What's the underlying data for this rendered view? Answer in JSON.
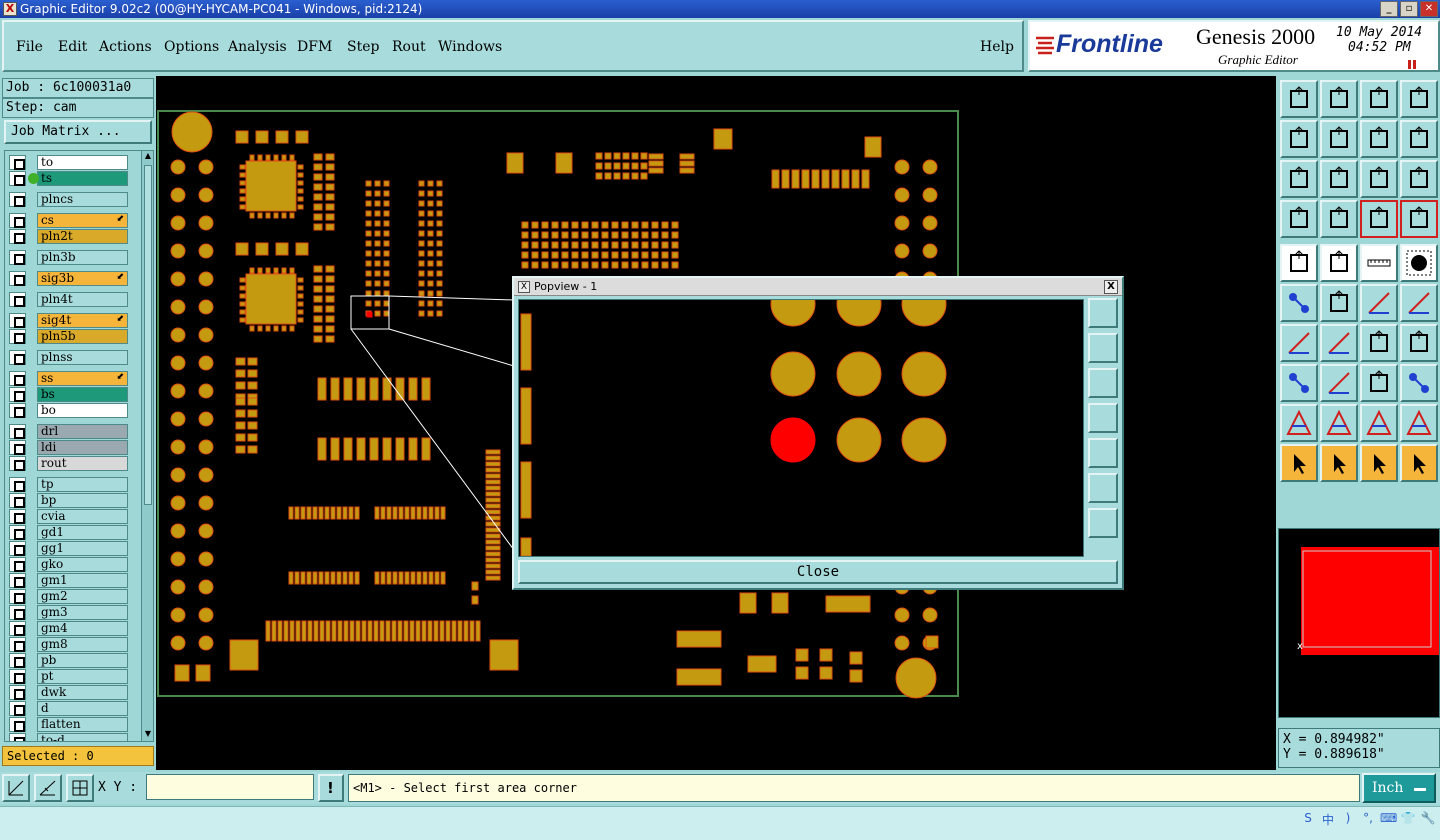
{
  "window": {
    "title": "Graphic Editor 9.02c2 (00@HY-HYCAM-PC041 - Windows, pid:2124)",
    "app_icon_glyph": "X"
  },
  "menu": {
    "file": "File",
    "edit": "Edit",
    "actions": "Actions",
    "options": "Options",
    "analysis": "Analysis",
    "dfm": "DFM",
    "step": "Step",
    "rout": "Rout",
    "windows": "Windows",
    "help": "Help"
  },
  "brand": {
    "logo": "Frontline",
    "product": "Genesis 2000",
    "subtitle": "Graphic Editor",
    "date": "10 May 2014",
    "time": "04:52 PM"
  },
  "job": {
    "job_label": "Job : 6c100031a0",
    "step_label": "Step: cam",
    "matrix_button": "Job Matrix ..."
  },
  "layers": [
    {
      "name": "to",
      "bg": "#ffffff",
      "group": 1
    },
    {
      "name": "ts",
      "bg": "#1e9a7a",
      "group": 1,
      "active": true
    },
    {
      "name": "plncs",
      "bg": "#a8dcdc",
      "group": 2
    },
    {
      "name": "cs",
      "bg": "#f5b43a",
      "group": 3,
      "arrow": true
    },
    {
      "name": "pln2t",
      "bg": "#d9a92a",
      "group": 3
    },
    {
      "name": "pln3b",
      "bg": "#a8dcdc",
      "group": 4
    },
    {
      "name": "sig3b",
      "bg": "#f5b43a",
      "group": 5,
      "arrow": true
    },
    {
      "name": "pln4t",
      "bg": "#a8dcdc",
      "group": 6
    },
    {
      "name": "sig4t",
      "bg": "#f5b43a",
      "group": 7,
      "arrow": true
    },
    {
      "name": "pln5b",
      "bg": "#d9a92a",
      "group": 7
    },
    {
      "name": "plnss",
      "bg": "#a8dcdc",
      "group": 8
    },
    {
      "name": "ss",
      "bg": "#f5b43a",
      "group": 9,
      "arrow": true
    },
    {
      "name": "bs",
      "bg": "#1e9a7a",
      "group": 9
    },
    {
      "name": "bo",
      "bg": "#ffffff",
      "group": 9
    },
    {
      "name": "drl",
      "bg": "#9aa8b0",
      "group": 10
    },
    {
      "name": "ldi",
      "bg": "#9aa8b0",
      "group": 10
    },
    {
      "name": "rout",
      "bg": "#d8d8d8",
      "group": 10
    },
    {
      "name": "tp",
      "bg": "#a8dcdc",
      "group": 11
    },
    {
      "name": "bp",
      "bg": "#a8dcdc",
      "group": 11
    },
    {
      "name": "cvia",
      "bg": "#a8dcdc",
      "group": 11
    },
    {
      "name": "gd1",
      "bg": "#a8dcdc",
      "group": 11
    },
    {
      "name": "gg1",
      "bg": "#a8dcdc",
      "group": 11
    },
    {
      "name": "gko",
      "bg": "#a8dcdc",
      "group": 11
    },
    {
      "name": "gm1",
      "bg": "#a8dcdc",
      "group": 11
    },
    {
      "name": "gm2",
      "bg": "#a8dcdc",
      "group": 11
    },
    {
      "name": "gm3",
      "bg": "#a8dcdc",
      "group": 11
    },
    {
      "name": "gm4",
      "bg": "#a8dcdc",
      "group": 11
    },
    {
      "name": "gm8",
      "bg": "#a8dcdc",
      "group": 11
    },
    {
      "name": "pb",
      "bg": "#a8dcdc",
      "group": 11
    },
    {
      "name": "pt",
      "bg": "#a8dcdc",
      "group": 11
    },
    {
      "name": "dwk",
      "bg": "#a8dcdc",
      "group": 11
    },
    {
      "name": "d",
      "bg": "#a8dcdc",
      "group": 11
    },
    {
      "name": "flatten",
      "bg": "#a8dcdc",
      "group": 11
    },
    {
      "name": "to-d",
      "bg": "#a8dcdc",
      "group": 11
    }
  ],
  "selected": "Selected : 0",
  "popview": {
    "title": "Popview - 1",
    "close_button": "Close",
    "close_glyph": "X"
  },
  "coords": {
    "x": "X = 0.894982\"",
    "y": "Y = 0.889618\""
  },
  "bottom": {
    "xy_label": "X Y :",
    "xy_value": "",
    "message": "<M1> - Select first area corner",
    "unit": "Inch",
    "warn_glyph": "!"
  },
  "colors": {
    "board_outline": "#4a8a4a",
    "pad": "#c49a10",
    "pad_edge": "#e05010",
    "highlight": "#ff0000",
    "canvas_bg": "#000000"
  },
  "icons": {
    "tray": [
      "S",
      "中",
      ")",
      "°,",
      "⌨",
      "👕",
      "🔧"
    ]
  }
}
